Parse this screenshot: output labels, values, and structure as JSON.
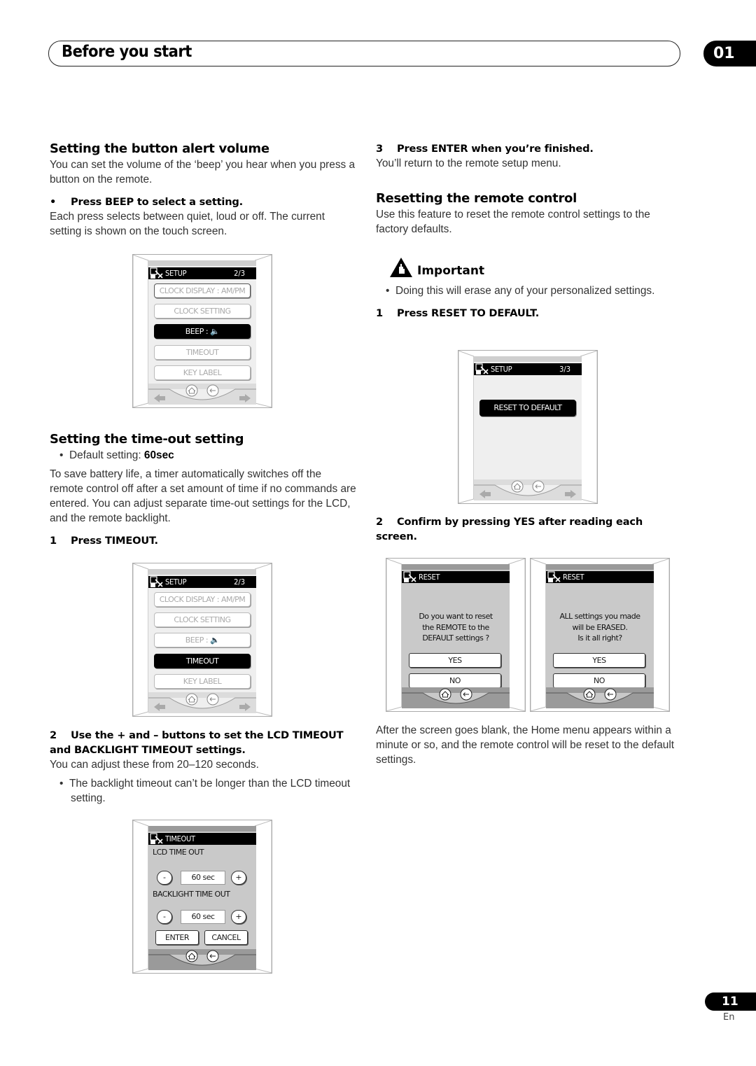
{
  "header": {
    "title": "Before you start",
    "chapter": "01"
  },
  "left": {
    "sec1": {
      "heading": "Setting the button alert volume",
      "intro": "You can set the volume of the ‘beep’ you hear when you press a button on the remote.",
      "bullet_step": "Press BEEP to select a setting.",
      "bullet_marker": "•",
      "body": "Each press selects between quiet, loud or off. The current setting is shown on the touch screen."
    },
    "sec2": {
      "heading": "Setting the time-out setting",
      "default_label": "Default setting: ",
      "default_value": "60sec",
      "body": "To save battery life, a timer automatically switches off the remote control off after a set amount of time if no commands are entered. You can adjust separate time-out settings for the LCD, and the remote backlight.",
      "step1_num": "1",
      "step1": "Press TIMEOUT.",
      "step2_num": "2",
      "step2": "Use the + and – buttons to set the LCD TIMEOUT and BACKLIGHT TIMEOUT settings.",
      "step2_body": "You can adjust these from 20–120 seconds.",
      "step2_bullet": "The backlight timeout can’t be longer than the LCD timeout setting."
    }
  },
  "right": {
    "step3_num": "3",
    "step3": "Press ENTER when you’re finished.",
    "step3_body": "You’ll return to the remote setup menu.",
    "sec3": {
      "heading": "Resetting the remote control",
      "intro": "Use this feature to reset the remote control settings to the factory defaults.",
      "important_label": "Important",
      "important_bullet": "Doing this will erase any of your personalized settings.",
      "step1_num": "1",
      "step1": "Press RESET TO DEFAULT.",
      "step2_num": "2",
      "step2": "Confirm by pressing YES after reading each screen.",
      "after": "After the screen goes blank, the Home menu appears within a minute or so, and the remote control will be reset to the default settings."
    }
  },
  "screens": {
    "setup_beep": {
      "title": "SETUP",
      "page": "2/3",
      "items": [
        "CLOCK DISPLAY : AM/PM",
        "CLOCK SETTING",
        "BEEP :",
        "TIMEOUT",
        "KEY LABEL"
      ],
      "selected": "BEEP :"
    },
    "setup_timeout": {
      "title": "SETUP",
      "page": "2/3",
      "items": [
        "CLOCK DISPLAY : AM/PM",
        "CLOCK SETTING",
        "BEEP :",
        "TIMEOUT",
        "KEY LABEL"
      ],
      "selected": "TIMEOUT"
    },
    "timeout": {
      "title": "TIMEOUT",
      "lcd_label": "LCD TIME OUT",
      "lcd_value": "60 sec",
      "backlight_label": "BACKLIGHT TIME OUT",
      "backlight_value": "60 sec",
      "minus": "-",
      "plus": "+",
      "enter": "ENTER",
      "cancel": "CANCEL"
    },
    "setup_reset": {
      "title": "SETUP",
      "page": "3/3",
      "button": "RESET TO DEFAULT"
    },
    "reset1": {
      "title": "RESET",
      "lines": [
        "Do you want to reset",
        "the REMOTE to the",
        "DEFAULT settings ?"
      ],
      "yes": "YES",
      "no": "NO"
    },
    "reset2": {
      "title": "RESET",
      "lines": [
        "ALL settings you made",
        "will be ERASED.",
        "Is it all right?"
      ],
      "yes": "YES",
      "no": "NO"
    }
  },
  "footer": {
    "page": "11",
    "lang": "En"
  }
}
